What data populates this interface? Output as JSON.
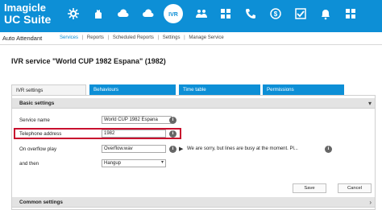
{
  "brand": {
    "line1": "Imagicle",
    "line2": "UC Suite"
  },
  "header": {
    "icons": [
      {
        "name": "gear-icon",
        "active": false
      },
      {
        "name": "hand-icon",
        "active": false
      },
      {
        "name": "cloud-icon",
        "active": false
      },
      {
        "name": "cloud-icon",
        "active": false
      },
      {
        "name": "ivr-icon",
        "active": true
      },
      {
        "name": "people-icon",
        "active": false
      },
      {
        "name": "grid-icon",
        "active": false
      },
      {
        "name": "phone-icon",
        "active": false
      },
      {
        "name": "dollar-icon",
        "active": false
      },
      {
        "name": "check-icon",
        "active": false
      },
      {
        "name": "bell-icon",
        "active": false
      },
      {
        "name": "grid-icon",
        "active": false
      }
    ],
    "accent": "#0d8fd6"
  },
  "subnav": {
    "app_title": "Auto Attendant",
    "items": [
      "Services",
      "Reports",
      "Scheduled Reports",
      "Settings",
      "Manage Service"
    ],
    "separator": "|"
  },
  "page": {
    "title": "IVR service \"World CUP 1982 Espana\" (1982)"
  },
  "tabs": [
    "IVR settings",
    "Behaviours",
    "Time table",
    "Permissions"
  ],
  "basic_settings": {
    "header": "Basic settings",
    "fields": {
      "service_name": {
        "label": "Service name",
        "value": "World CUP 1982 Espana"
      },
      "telephone_address": {
        "label": "Telephone address",
        "value": "1982"
      },
      "overflow_play": {
        "label": "On overflow play",
        "value": "Overflow.wav",
        "message": "We are sorry, but lines are busy at the moment. Pl..."
      },
      "and_then": {
        "label": "and then",
        "value": "Hangup"
      }
    },
    "save_label": "Save",
    "cancel_label": "Cancel"
  },
  "common_settings": {
    "header": "Common settings"
  },
  "icons": {
    "info": "i",
    "play": "▶",
    "chevron_down": "▾",
    "chevron_right": "›",
    "dropdown": "▾"
  }
}
